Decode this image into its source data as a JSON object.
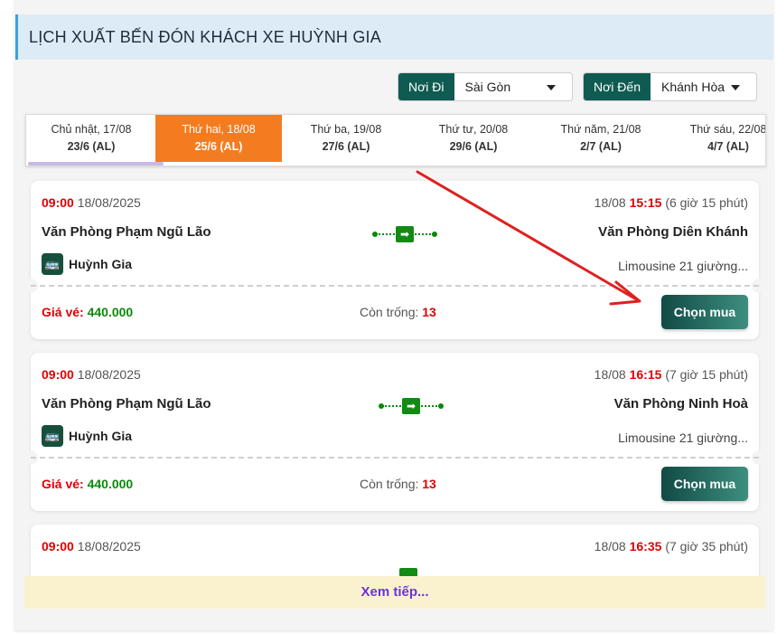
{
  "section_title": "LỊCH XUẤT BẾN ĐÓN KHÁCH XE HUỲNH GIA",
  "filters": {
    "from": {
      "label": "Nơi Đi",
      "value": "Sài Gòn"
    },
    "to": {
      "label": "Nơi Đến",
      "value": "Khánh Hòa"
    }
  },
  "date_tabs": [
    {
      "day": "Chủ nhật, 17/08",
      "lunar": "23/6 (AL)",
      "active": false
    },
    {
      "day": "Thứ hai, 18/08",
      "lunar": "25/6 (AL)",
      "active": true
    },
    {
      "day": "Thứ ba, 19/08",
      "lunar": "27/6 (AL)",
      "active": false
    },
    {
      "day": "Thứ tư, 20/08",
      "lunar": "29/6 (AL)",
      "active": false
    },
    {
      "day": "Thứ năm, 21/08",
      "lunar": "2/7 (AL)",
      "active": false
    },
    {
      "day": "Thứ sáu, 22/08",
      "lunar": "4/7 (AL)",
      "active": false
    }
  ],
  "trips": [
    {
      "dep_time": "09:00",
      "dep_date": "18/08/2025",
      "arr_date": "18/08",
      "arr_time": "15:15",
      "duration": "(6 giờ 15 phút)",
      "from": "Văn Phòng Phạm Ngũ Lão",
      "to": "Văn Phòng Diên Khánh",
      "operator": "Huỳnh Gia",
      "vehicle": "Limousine 21 giường...",
      "price_label": "Giá vé:",
      "price": "440.000",
      "seats_label": "Còn trống:",
      "seats": "13",
      "buy_label": "Chọn mua"
    },
    {
      "dep_time": "09:00",
      "dep_date": "18/08/2025",
      "arr_date": "18/08",
      "arr_time": "16:15",
      "duration": "(7 giờ 15 phút)",
      "from": "Văn Phòng Phạm Ngũ Lão",
      "to": "Văn Phòng Ninh Hoà",
      "operator": "Huỳnh Gia",
      "vehicle": "Limousine 21 giường...",
      "price_label": "Giá vé:",
      "price": "440.000",
      "seats_label": "Còn trống:",
      "seats": "13",
      "buy_label": "Chọn mua"
    },
    {
      "dep_time": "09:00",
      "dep_date": "18/08/2025",
      "arr_date": "18/08",
      "arr_time": "16:35",
      "duration": "(7 giờ 35 phút)"
    }
  ],
  "load_more_label": "Xem tiếp...",
  "colors": {
    "accent_orange": "#f47c20",
    "brand_green": "#0f5b52",
    "price_red": "#e00000",
    "price_green": "#0a8a0a",
    "annotation_arrow": "#e02020"
  }
}
